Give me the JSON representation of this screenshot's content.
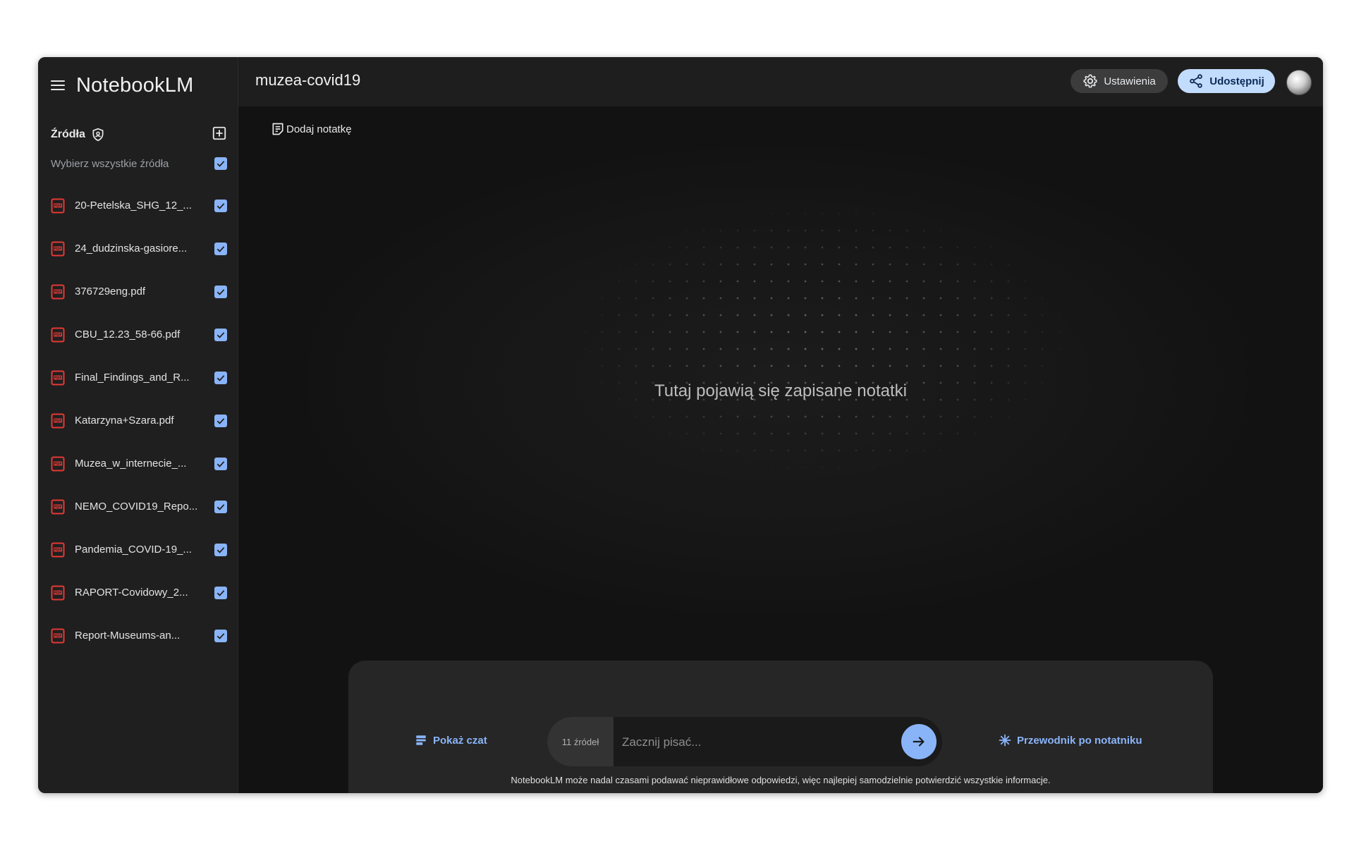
{
  "app": {
    "name": "NotebookLM"
  },
  "notebook": {
    "title": "muzea-covid19"
  },
  "header": {
    "settings_label": "Ustawienia",
    "share_label": "Udostępnij"
  },
  "sources": {
    "title": "Źródła",
    "select_all_label": "Wybierz wszystkie źródła",
    "items": [
      {
        "name": "20-Petelska_SHG_12_...",
        "checked": true
      },
      {
        "name": "24_dudzinska-gasiore...",
        "checked": true
      },
      {
        "name": "376729eng.pdf",
        "checked": true
      },
      {
        "name": "CBU_12.23_58-66.pdf",
        "checked": true
      },
      {
        "name": "Final_Findings_and_R...",
        "checked": true
      },
      {
        "name": "Katarzyna+Szara.pdf",
        "checked": true
      },
      {
        "name": "Muzea_w_internecie_...",
        "checked": true
      },
      {
        "name": "NEMO_COVID19_Repo...",
        "checked": true
      },
      {
        "name": "Pandemia_COVID-19_...",
        "checked": true
      },
      {
        "name": "RAPORT-Covidowy_2...",
        "checked": true
      },
      {
        "name": "Report-Museums-an...",
        "checked": true
      }
    ]
  },
  "notes": {
    "add_note_label": "Dodaj notatkę",
    "empty_text": "Tutaj pojawią się zapisane notatki"
  },
  "chat": {
    "show_chat_label": "Pokaż czat",
    "source_count": "11 źródeł",
    "input_placeholder": "Zacznij pisać...",
    "input_value": "",
    "guide_label": "Przewodnik po notatniku",
    "disclaimer": "NotebookLM może nadal czasami podawać nieprawidłowe odpowiedzi, więc najlepiej samodzielnie potwierdzić wszystkie informacje."
  },
  "colors": {
    "accent": "#8ab4f8",
    "share_bg": "#c2dcfd",
    "pdf_red": "#e53935",
    "sidebar_bg": "#1f1f1f",
    "main_bg": "#121212"
  }
}
